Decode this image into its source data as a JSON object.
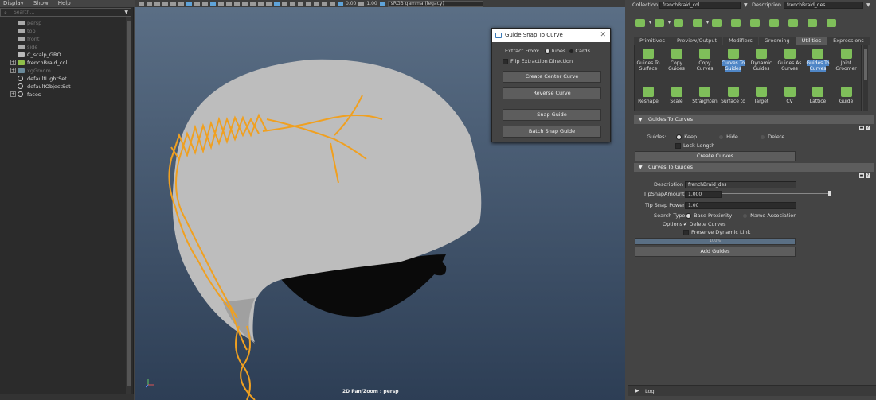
{
  "outliner": {
    "menu": [
      "Display",
      "Show",
      "Help"
    ],
    "search_placeholder": "Search...",
    "items": [
      {
        "label": "persp",
        "dim": true,
        "icon": "camera-icon"
      },
      {
        "label": "top",
        "dim": true,
        "icon": "camera-icon"
      },
      {
        "label": "front",
        "dim": true,
        "icon": "camera-icon"
      },
      {
        "label": "side",
        "dim": true,
        "icon": "camera-icon"
      },
      {
        "label": "C_scalp_GRO",
        "dim": false,
        "icon": "transform-icon"
      },
      {
        "label": "frenchBraid_col",
        "dim": false,
        "icon": "xgen-collection-icon",
        "expand": "+"
      },
      {
        "label": "xgGroom",
        "dim": true,
        "icon": "groom-icon",
        "expand": "+"
      },
      {
        "label": "defaultLightSet",
        "dim": false,
        "icon": "set-icon"
      },
      {
        "label": "defaultObjectSet",
        "dim": false,
        "icon": "set-icon"
      },
      {
        "label": "faces",
        "dim": false,
        "icon": "set-icon",
        "expand": "+"
      }
    ]
  },
  "viewport": {
    "colorspace": "sRGB gamma (legacy)",
    "exposure": "0.00",
    "gamma": "1.00",
    "label": "2D Pan/Zoom : persp",
    "colors": {
      "mesh": "#bdbdbd",
      "braid": "#f0a020"
    }
  },
  "snap_window": {
    "title": "Guide Snap To Curve",
    "extract_label": "Extract From:",
    "opt_tubes": "Tubes",
    "opt_cards": "Cards",
    "flip_label": "Flip Extraction Direction",
    "btn_center": "Create Center Curve",
    "btn_reverse": "Reverse Curve",
    "btn_snap": "Snap Guide",
    "btn_batch": "Batch Snap Guide"
  },
  "right_panel": {
    "collection_label": "Collection",
    "collection_value": "frenchBraid_col",
    "description_label": "Description",
    "description_value": "frenchBraid_des",
    "tabs": [
      {
        "label": "Primitives",
        "active": false
      },
      {
        "label": "Preview/Output",
        "active": false
      },
      {
        "label": "Modifiers",
        "active": false
      },
      {
        "label": "Grooming",
        "active": false
      },
      {
        "label": "Utilities",
        "active": true
      },
      {
        "label": "Expressions",
        "active": false
      }
    ],
    "shelf_row1": [
      {
        "label": "Guides To Surface"
      },
      {
        "label": "Copy Guides"
      },
      {
        "label": "Copy Curves"
      },
      {
        "label": "Curves To Guides",
        "selected": true
      },
      {
        "label": "Dynamic Guides"
      },
      {
        "label": "Guides As Curves"
      },
      {
        "label": "Guides To Curves",
        "selected": true
      },
      {
        "label": "Joint Groomer"
      }
    ],
    "shelf_row2": [
      {
        "label": "Reshape"
      },
      {
        "label": "Scale"
      },
      {
        "label": "Straighten"
      },
      {
        "label": "Surface to"
      },
      {
        "label": "Target"
      },
      {
        "label": "CV"
      },
      {
        "label": "Lattice"
      },
      {
        "label": "Guide"
      }
    ],
    "guides_to_curves": {
      "header": "Guides To Curves",
      "guides_label": "Guides:",
      "opt_keep": "Keep",
      "opt_hide": "Hide",
      "opt_delete": "Delete",
      "lock_length": "Lock Length",
      "btn_create": "Create Curves"
    },
    "curves_to_guides": {
      "header": "Curves To Guides",
      "description_label": "Description",
      "description_value": "frenchBraid_des",
      "tip_snap_amount_label": "TipSnapAmount",
      "tip_snap_amount": "1.000",
      "tip_snap_power_label": "Tip Snap Power",
      "tip_snap_power": "1.00",
      "search_type_label": "Search Type",
      "opt_base": "Base Proximity",
      "opt_name": "Name Association",
      "options_label": "Options",
      "delete_curves": "Delete Curves",
      "preserve_link": "Preserve Dynamic Link",
      "progress_text": "100%",
      "btn_add": "Add Guides"
    },
    "log_label": "Log"
  }
}
